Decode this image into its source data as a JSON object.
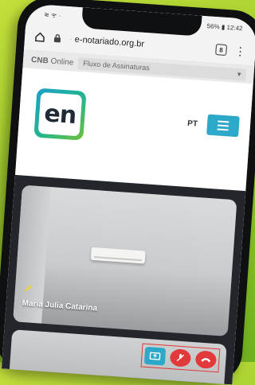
{
  "status": {
    "left": "≋ ᯤ ·",
    "right": "56% ▮ 12:42"
  },
  "browser": {
    "url_blurred": "·",
    "url": "e-notariado.org.br",
    "tab_count": "8"
  },
  "cnb_bar": {
    "brand_bold": "CNB",
    "brand_light": "Online",
    "flow": "Fluxo de Assinaturas"
  },
  "header": {
    "logo_text": "en",
    "language": "PT"
  },
  "video": {
    "participant_name": "Maria Julia Catarina"
  },
  "colors": {
    "accent": "#2ea8c8",
    "danger": "#e23a3a",
    "background": "#a6d22f"
  }
}
